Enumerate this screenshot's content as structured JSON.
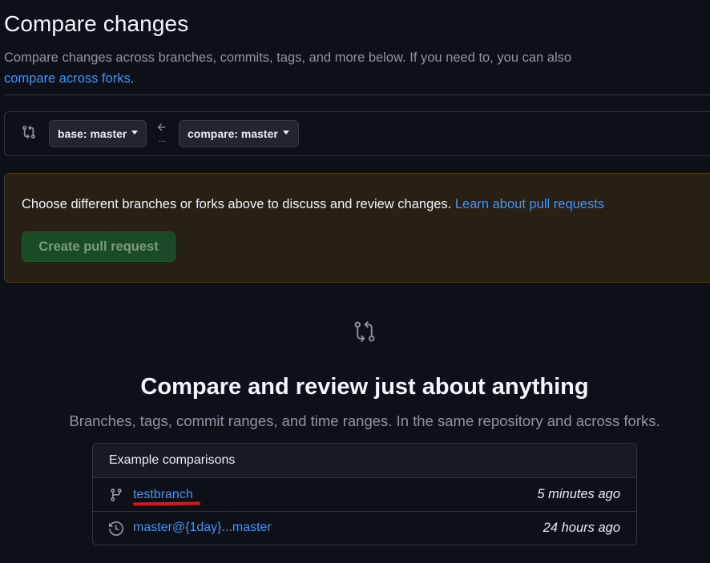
{
  "header": {
    "title": "Compare changes",
    "subtitle": "Compare changes across branches, commits, tags, and more below. If you need to, you can also",
    "subtitle_link": "compare across forks",
    "subtitle_end": "."
  },
  "range": {
    "icon": "git-compare-icon",
    "base_label": "base: master",
    "arrow_icon": "arrow-left-icon",
    "dots": "...",
    "compare_label": "compare: master"
  },
  "flash": {
    "text": "Choose different branches or forks above to discuss and review changes.",
    "link": "Learn about pull requests",
    "button": "Create pull request"
  },
  "blankslate": {
    "icon": "git-compare-icon",
    "title": "Compare and review just about anything",
    "subtitle": "Branches, tags, commit ranges, and time ranges. In the same repository and across forks."
  },
  "examples": {
    "header": "Example comparisons",
    "rows": [
      {
        "icon": "git-branch-icon",
        "label": "testbranch",
        "time": "5 minutes ago",
        "annotated": true
      },
      {
        "icon": "history-icon",
        "label": "master@{1day}...master",
        "time": "24 hours ago",
        "annotated": false
      }
    ]
  },
  "colors": {
    "background": "#0d1117",
    "link": "#4493f8",
    "flash_bg": "#272115",
    "button_green": "#1a4a26",
    "annotation_red": "#e0141b"
  }
}
